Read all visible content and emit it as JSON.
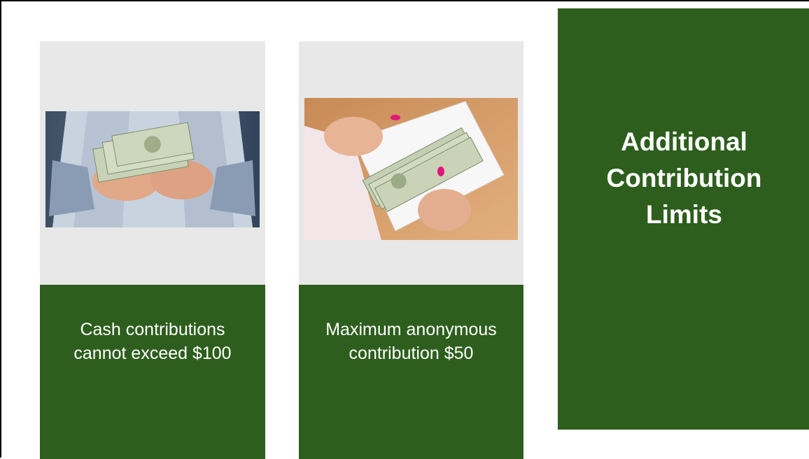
{
  "slide": {
    "title_lines": [
      "Additional",
      "Contribution",
      "Limits"
    ],
    "cards": [
      {
        "caption_lines": [
          "Cash contributions",
          "cannot exceed $100"
        ],
        "photo_subject": "hands-counting-dollar-bills"
      },
      {
        "caption_lines": [
          "Maximum anonymous",
          "contribution $50"
        ],
        "photo_subject": "hands-opening-envelope-of-cash"
      }
    ],
    "colors": {
      "panel_green": "#2d5e1d",
      "card_gray": "#e8e8e8",
      "text": "#ffffff"
    }
  }
}
